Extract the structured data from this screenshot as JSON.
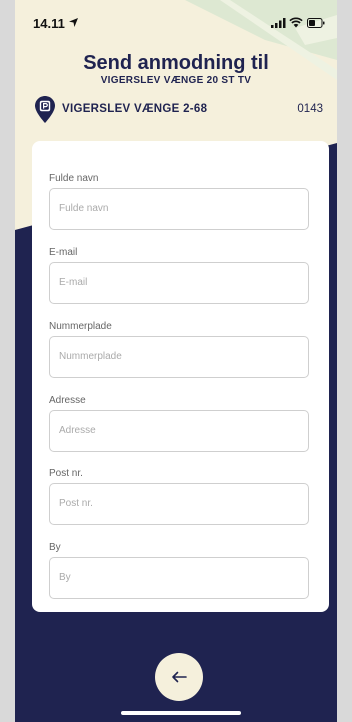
{
  "status_bar": {
    "time": "14.11"
  },
  "header": {
    "title": "Send anmodning til",
    "subtitle": "VIGERSLEV VÆNGE 20 ST TV"
  },
  "location": {
    "name": "VIGERSLEV VÆNGE 2-68",
    "code": "0143"
  },
  "form": {
    "fields": [
      {
        "label": "Fulde navn",
        "placeholder": "Fulde navn"
      },
      {
        "label": "E-mail",
        "placeholder": "E-mail"
      },
      {
        "label": "Nummerplade",
        "placeholder": "Nummerplade"
      },
      {
        "label": "Adresse",
        "placeholder": "Adresse"
      },
      {
        "label": "Post nr.",
        "placeholder": "Post nr."
      },
      {
        "label": "By",
        "placeholder": "By"
      }
    ]
  },
  "colors": {
    "navy": "#1f2350",
    "cream": "#f5f0dc",
    "map_green": "#dde8d2"
  },
  "icons": {
    "status": [
      "location-arrow-icon",
      "signal-icon",
      "wifi-icon",
      "battery-icon"
    ],
    "location": "parking-pin-icon",
    "back": "arrow-left-icon"
  }
}
